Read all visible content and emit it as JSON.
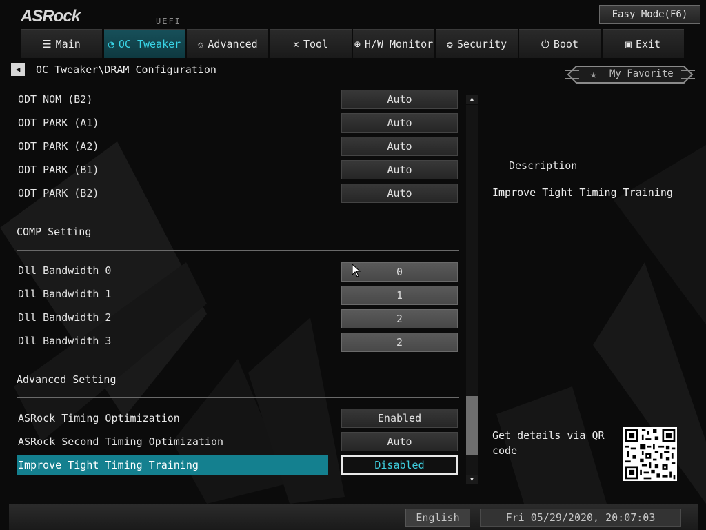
{
  "brand": {
    "logo": "ASRock",
    "uefi": "UEFI"
  },
  "easy_mode_label": "Easy Mode(F6)",
  "tabs": [
    {
      "icon": "list-icon",
      "glyph": "☰",
      "label": "Main"
    },
    {
      "icon": "speedometer-icon",
      "glyph": "◔",
      "label": "OC Tweaker",
      "active": true
    },
    {
      "icon": "star-outline-icon",
      "glyph": "✩",
      "label": "Advanced"
    },
    {
      "icon": "tools-icon",
      "glyph": "✕",
      "label": "Tool"
    },
    {
      "icon": "globe-icon",
      "glyph": "⊕",
      "label": "H/W Monitor"
    },
    {
      "icon": "shield-icon",
      "glyph": "✪",
      "label": "Security"
    },
    {
      "icon": "power-icon",
      "glyph": "⏻",
      "label": "Boot"
    },
    {
      "icon": "exit-door-icon",
      "glyph": "▣",
      "label": "Exit"
    }
  ],
  "breadcrumb": "OC Tweaker\\DRAM Configuration",
  "favorite_label": "My Favorite",
  "rows_top": [
    {
      "label": "ODT NOM  (B2)",
      "value": "Auto"
    },
    {
      "label": "ODT PARK (A1)",
      "value": "Auto"
    },
    {
      "label": "ODT PARK (A2)",
      "value": "Auto"
    },
    {
      "label": "ODT PARK (B1)",
      "value": "Auto"
    },
    {
      "label": "ODT PARK (B2)",
      "value": "Auto"
    }
  ],
  "section_comp": "COMP Setting",
  "rows_comp": [
    {
      "label": "Dll Bandwidth 0",
      "value": "0"
    },
    {
      "label": "Dll Bandwidth 1",
      "value": "1"
    },
    {
      "label": "Dll Bandwidth 2",
      "value": "2"
    },
    {
      "label": "Dll Bandwidth 3",
      "value": "2"
    }
  ],
  "section_adv": "Advanced Setting",
  "rows_adv": [
    {
      "label": "ASRock Timing Optimization",
      "value": "Enabled"
    },
    {
      "label": "ASRock Second Timing Optimization",
      "value": "Auto"
    }
  ],
  "selected_row": {
    "label": "Improve Tight Timing Training",
    "value": "Disabled"
  },
  "description": {
    "title": "Description",
    "text": "Improve Tight Timing Training",
    "qr_text": "Get details via QR code"
  },
  "footer": {
    "language": "English",
    "datetime": "Fri 05/29/2020, 20:07:03"
  },
  "colors": {
    "accent": "#39d4e6",
    "selected_bg": "#14808f"
  }
}
